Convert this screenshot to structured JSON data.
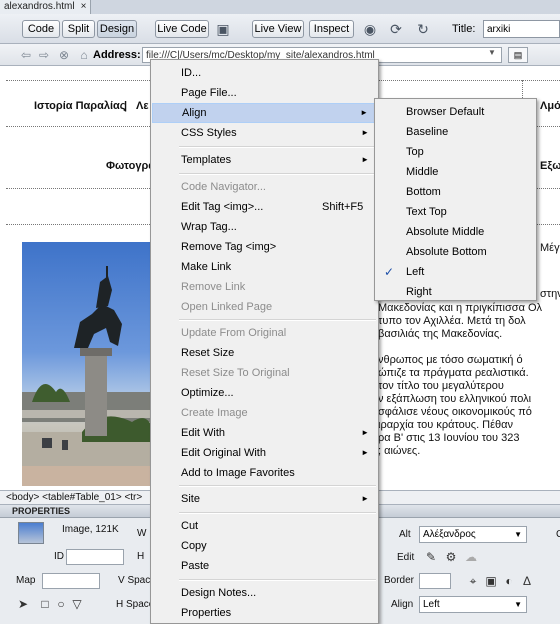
{
  "document_tab": {
    "filename": "alexandros.html",
    "close_glyph": "×"
  },
  "toolbar": {
    "code": "Code",
    "split": "Split",
    "design": "Design",
    "live_code": "Live Code",
    "live_view": "Live View",
    "inspect": "Inspect",
    "title_label": "Title:",
    "title_value": "arxiki"
  },
  "address_bar": {
    "label": "Address:",
    "value": "file:///C|/Users/mc/Desktop/my_site/alexandros.html"
  },
  "page": {
    "nav_row1": [
      "Ιστορία Παραλίας",
      "|",
      "Λε",
      "Λμό"
    ],
    "nav_row2": [
      "Φωτογρα",
      "Εξω"
    ],
    "body_lines": [
      "Μέγα",
      "στην",
      "Μακεδονίας και η πριγκίπισσα Ολ",
      "τυπο τον Αχιλλέα. Μετά τη δολ",
      "βασιλιάς της Μακεδονίας.",
      "νθρωπος με τόσο σωματική ό",
      "ώπιζε τα πράγματα ρεαλιστικά.",
      "τον τίτλο του μεγαλύτερου",
      "ν εξάπλωση του ελληνικού πολι",
      "σφάλισε νέους οικονομικούς πό",
      "ιραρχία   του   κράτους.  Πέθαν",
      "ρα Β' στις 13 Ιουνίου του 323",
      "; αιώνες."
    ]
  },
  "status_bar": {
    "tag_path": "<body> <table#Table_01> <tr>"
  },
  "properties": {
    "header": "PROPERTIES",
    "image_info": "Image, 121K",
    "w_label": "W",
    "h_label": "H",
    "id_label": "ID",
    "id_value": "",
    "map_label": "Map",
    "map_value": "",
    "vspace_label": "V Space",
    "hspace_label": "H Space",
    "alt_label": "Alt",
    "alt_value": "Αλέξανδρος",
    "edit_label": "Edit",
    "border_label": "Border",
    "border_value": "",
    "align_label": "Align",
    "align_value": "Left",
    "class_label": "C"
  },
  "context_menu": {
    "items": [
      {
        "label": "ID...",
        "shortcut": "",
        "submenu": false,
        "disabled": false
      },
      {
        "label": "Page File...",
        "shortcut": "",
        "submenu": false,
        "disabled": false
      },
      {
        "label": "Align",
        "shortcut": "",
        "submenu": true,
        "disabled": false
      },
      {
        "label": "CSS Styles",
        "shortcut": "",
        "submenu": true,
        "disabled": false
      },
      {
        "label": "Templates",
        "shortcut": "",
        "submenu": true,
        "disabled": false
      },
      {
        "label": "Code Navigator...",
        "shortcut": "",
        "submenu": false,
        "disabled": true
      },
      {
        "label": "Edit Tag <img>...",
        "shortcut": "Shift+F5",
        "submenu": false,
        "disabled": false
      },
      {
        "label": "Wrap Tag...",
        "shortcut": "",
        "submenu": false,
        "disabled": false
      },
      {
        "label": "Remove Tag <img>",
        "shortcut": "",
        "submenu": false,
        "disabled": false
      },
      {
        "label": "Make Link",
        "shortcut": "",
        "submenu": false,
        "disabled": false
      },
      {
        "label": "Remove Link",
        "shortcut": "",
        "submenu": false,
        "disabled": true
      },
      {
        "label": "Open Linked Page",
        "shortcut": "",
        "submenu": false,
        "disabled": true
      },
      {
        "label": "Update From Original",
        "shortcut": "",
        "submenu": false,
        "disabled": true
      },
      {
        "label": "Reset Size",
        "shortcut": "",
        "submenu": false,
        "disabled": false
      },
      {
        "label": "Reset Size To Original",
        "shortcut": "",
        "submenu": false,
        "disabled": true
      },
      {
        "label": "Optimize...",
        "shortcut": "",
        "submenu": false,
        "disabled": false
      },
      {
        "label": "Create Image",
        "shortcut": "",
        "submenu": false,
        "disabled": true
      },
      {
        "label": "Edit With",
        "shortcut": "",
        "submenu": true,
        "disabled": false
      },
      {
        "label": "Edit Original With",
        "shortcut": "",
        "submenu": true,
        "disabled": false
      },
      {
        "label": "Add to Image Favorites",
        "shortcut": "",
        "submenu": false,
        "disabled": false
      },
      {
        "label": "Site",
        "shortcut": "",
        "submenu": true,
        "disabled": false
      },
      {
        "label": "Cut",
        "shortcut": "",
        "submenu": false,
        "disabled": false
      },
      {
        "label": "Copy",
        "shortcut": "",
        "submenu": false,
        "disabled": false
      },
      {
        "label": "Paste",
        "shortcut": "",
        "submenu": false,
        "disabled": false
      },
      {
        "label": "Design Notes...",
        "shortcut": "",
        "submenu": false,
        "disabled": false
      },
      {
        "label": "Properties",
        "shortcut": "",
        "submenu": false,
        "disabled": false
      }
    ],
    "highlighted": "Align"
  },
  "align_submenu": {
    "items": [
      "Browser Default",
      "Baseline",
      "Top",
      "Middle",
      "Bottom",
      "Text Top",
      "Absolute Middle",
      "Absolute Bottom",
      "Left",
      "Right"
    ],
    "checked": "Left",
    "check_glyph": "✓"
  },
  "colors": {
    "menu_background": "#f0f0f0",
    "menu_highlight": "#c1d2ee",
    "disabled_text": "#8c8c8c",
    "toolbar_bg": "#dfe4ea"
  }
}
